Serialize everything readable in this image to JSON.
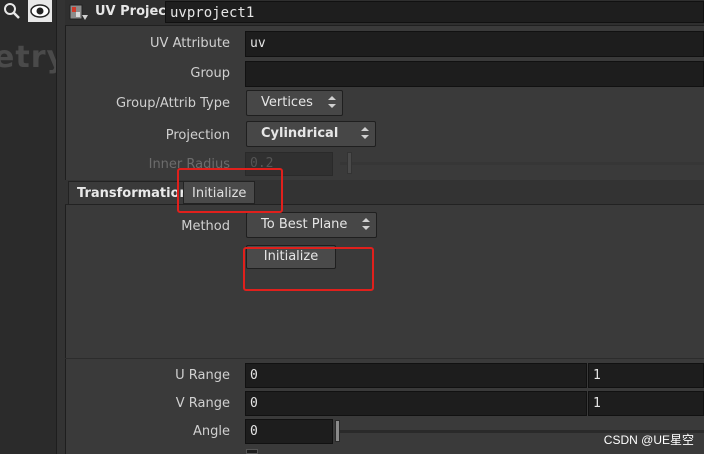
{
  "left_panel": {
    "ghost_text": "etry"
  },
  "header": {
    "node_type": "UV Project",
    "node_name": "uvproject1"
  },
  "params": {
    "uv_attribute": {
      "label": "UV Attribute",
      "value": "uv"
    },
    "group": {
      "label": "Group",
      "value": ""
    },
    "group_attrib_type": {
      "label": "Group/Attrib Type",
      "value": "Vertices"
    },
    "projection": {
      "label": "Projection",
      "value": "Cylindrical"
    },
    "inner_radius": {
      "label": "Inner Radius",
      "value": "0.2"
    }
  },
  "tabs": [
    {
      "label": "Transformation"
    },
    {
      "label": "Initialize"
    }
  ],
  "transformation": {
    "method": {
      "label": "Method",
      "value": "To Best Plane"
    },
    "initialize_button": "Initialize"
  },
  "ranges": {
    "u_range": {
      "label": "U Range",
      "v1": "0",
      "v2": "1"
    },
    "v_range": {
      "label": "V Range",
      "v1": "0",
      "v2": "1"
    },
    "angle": {
      "label": "Angle",
      "value": "0"
    }
  },
  "watermark": "CSDN @UE星空"
}
